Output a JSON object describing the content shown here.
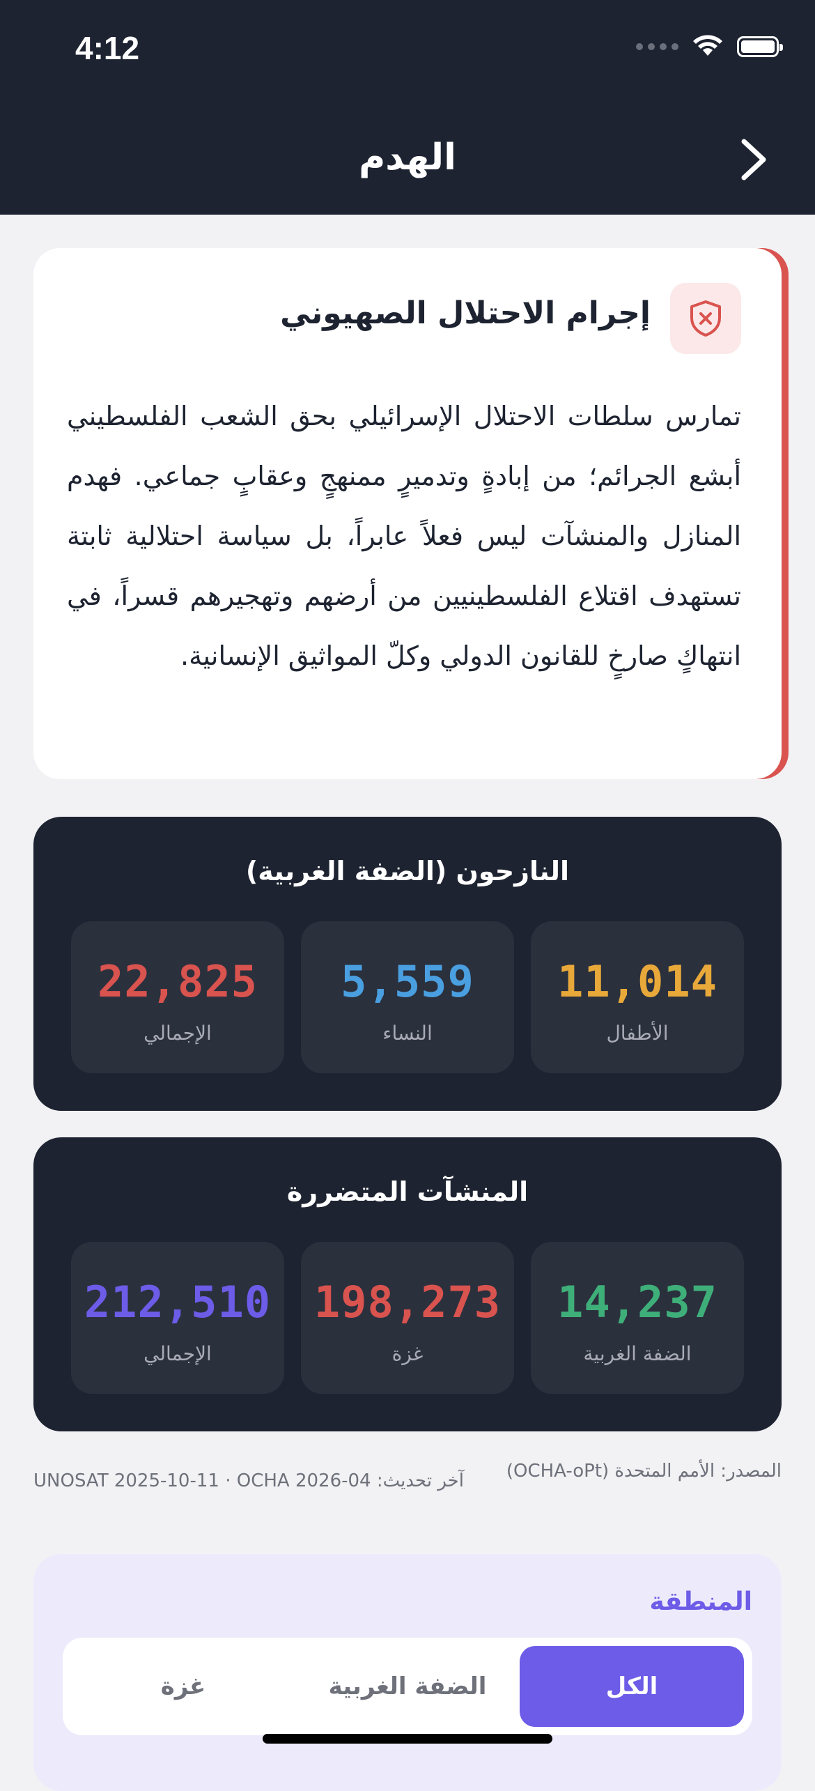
{
  "status_bar": {
    "time": "4:12",
    "icons": [
      "signal-dots-icon",
      "wifi-icon",
      "battery-icon"
    ]
  },
  "header": {
    "title": "الهدم",
    "back_icon": "chevron-right-icon"
  },
  "intro": {
    "icon": "shield-x-icon",
    "title": "إجرام الاحتلال الصهيوني",
    "body": "تمارس سلطات الاحتلال الإسرائيلي بحق الشعب الفلسطيني أبشع الجرائم؛ من إبادةٍ وتدميرٍ ممنهجٍ وعقابٍ جماعي. فهدم المنازل والمنشآت ليس فعلاً عابراً، بل سياسة احتلالية ثابتة تستهدف اقتلاع الفلسطينيين من أرضهم وتهجيرهم قسراً، في انتهاكٍ صارخٍ للقانون الدولي وكلّ المواثيق الإنسانية."
  },
  "displaced": {
    "title": "النازحون (الضفة الغربية)",
    "stats": [
      {
        "label": "الأطفال",
        "value": "11,014"
      },
      {
        "label": "النساء",
        "value": "5,559"
      },
      {
        "label": "الإجمالي",
        "value": "22,825"
      }
    ]
  },
  "structures": {
    "title": "المنشآت المتضررة",
    "stats": [
      {
        "label": "الضفة الغربية",
        "value": "14,237"
      },
      {
        "label": "غزة",
        "value": "198,273"
      },
      {
        "label": "الإجمالي",
        "value": "212,510"
      }
    ]
  },
  "source": {
    "text": "المصدر: الأمم المتحدة (OCHA-oPt)",
    "updated": "آخر تحديث: UNOSAT 2025-10-11 · OCHA 2026-04"
  },
  "region": {
    "label": "المنطقة",
    "options": [
      "الكل",
      "الضفة الغربية",
      "غزة"
    ],
    "selected": "الكل"
  },
  "colors": {
    "header_bg": "#1E2331",
    "accent": "#6C5CE7",
    "red": "#D9534F",
    "blue": "#4A9FE0",
    "amber": "#E8A93A",
    "green": "#3FAF7A",
    "purple": "#6C5CE7"
  }
}
